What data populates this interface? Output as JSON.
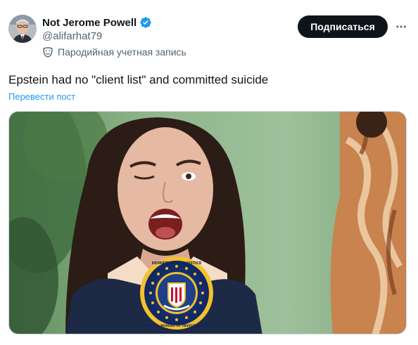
{
  "author": {
    "display_name": "Not Jerome Powell",
    "handle": "@alifarhat79",
    "parody_label": "Пародийная учетная запись",
    "verified_icon": "verified-badge-icon",
    "parody_icon": "theater-mask-icon",
    "avatar_icon": "avatar-photo"
  },
  "actions": {
    "subscribe_label": "Подписаться",
    "more_icon": "more-horizontal-icon"
  },
  "tweet": {
    "text": "Epstein had no \"client list\" and committed suicide",
    "translate_label": "Перевести пост"
  },
  "media": {
    "description_icon": "meme-image",
    "seal_top_text": "DEPARTMENT OF JUSTICE",
    "seal_bottom_text": "FEDERAL BUREAU OF INVESTIGATION"
  },
  "colors": {
    "text_primary": "#0f1419",
    "text_secondary": "#536471",
    "link": "#1d9bf0",
    "verified": "#1d9bf0",
    "button_bg": "#0f1419",
    "button_text": "#ffffff"
  }
}
